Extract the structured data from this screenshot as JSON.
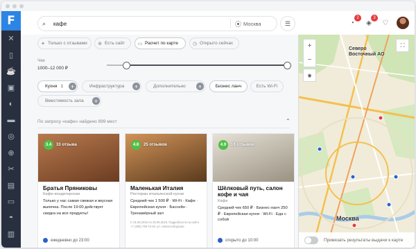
{
  "app": {
    "logo_letter": "F"
  },
  "sidebar": {
    "items": [
      {
        "icon": "cutlery-icon",
        "glyph": "✕"
      },
      {
        "icon": "cup-icon",
        "glyph": "▯"
      },
      {
        "icon": "coffee-icon",
        "glyph": "☕"
      },
      {
        "icon": "wallet-icon",
        "glyph": "▣"
      },
      {
        "icon": "palette-icon",
        "glyph": "◐"
      },
      {
        "icon": "car-icon",
        "glyph": "▬"
      },
      {
        "icon": "disc-icon",
        "glyph": "◎"
      },
      {
        "icon": "globe-icon",
        "glyph": "⊕"
      },
      {
        "icon": "scissors-icon",
        "glyph": "✂"
      },
      {
        "icon": "gift-icon",
        "glyph": "▤"
      },
      {
        "icon": "washer-icon",
        "glyph": "▭"
      },
      {
        "icon": "car-front-icon",
        "glyph": "◓"
      },
      {
        "icon": "card-icon",
        "glyph": "▥"
      }
    ]
  },
  "header": {
    "search_query": "кафе",
    "city": "Москва",
    "notifications_count": "2",
    "messages_count": "3"
  },
  "filters": {
    "quick": [
      {
        "label": "Только с отзывами",
        "icon": "star-icon"
      },
      {
        "label": "Есть сайт",
        "icon": "globe-icon"
      },
      {
        "label": "Расчет по карте",
        "icon": "card-icon",
        "active": true
      },
      {
        "label": "Открыто сейчас",
        "icon": "clock-icon"
      }
    ],
    "price_label": "Чек",
    "price_value": "1000–12 000 ₽",
    "price_range_fraction": [
      0.0,
      1.0
    ],
    "row2": [
      {
        "label": "Кухня",
        "count": "1"
      },
      {
        "label": "Инфраструктура"
      },
      {
        "label": "Дополнительно"
      },
      {
        "label": "Бизнес ланч"
      },
      {
        "label": "Есть Wi-Fi"
      }
    ],
    "row3": [
      {
        "label": "Вместимость зала"
      }
    ],
    "result_text": "По запросу «кафе» найдено 899 мест"
  },
  "cards": [
    {
      "rating": "3.4",
      "reviews": "33 отзыва",
      "name": "Братья Пряниковы",
      "category": "Кафе-кондитерская",
      "description": "Только у нас самая свежая и вкусная выпечка. После 19:00 действует скидка на все продукты!",
      "small": "",
      "hours": "ежедневно до 23:00",
      "photo_colors": [
        "#b87a4d",
        "#6b3c22"
      ]
    },
    {
      "rating": "4.8",
      "reviews": "25 отзывов",
      "name": "Маленькая Италия",
      "category": "Ресторан итальянской кухни",
      "description": "Средний чек 1 500 ₽ · Wi-Fi · Кафе · Европейская кухня · Бассейн · Тренажёрный зал",
      "small": "С 01.06.2016 по 25.06.2016. Подробности на сайте\n+7 (495) 738-73-20, ул. Новослободская",
      "hours": "",
      "photo_colors": [
        "#d19358",
        "#5a3a1e"
      ]
    },
    {
      "rating": "4.9",
      "reviews": "16 отзывов",
      "name": "Шёлковый путь, салон кофе и чая",
      "category": "Кафе",
      "description": "Средний чек 650 ₽ · Бизнес-ланч 250 ₽ · Европейская кухня · Wi-Fi · Еда с собой",
      "small": "",
      "hours": "открыто до 10:00",
      "photo_colors": [
        "#e6e1d6",
        "#9a9283"
      ]
    }
  ],
  "map": {
    "label_north": "Северо\nВосточный АО",
    "label_center": "Москва",
    "bottom_text": "Привязать результаты выдачи к карте"
  }
}
